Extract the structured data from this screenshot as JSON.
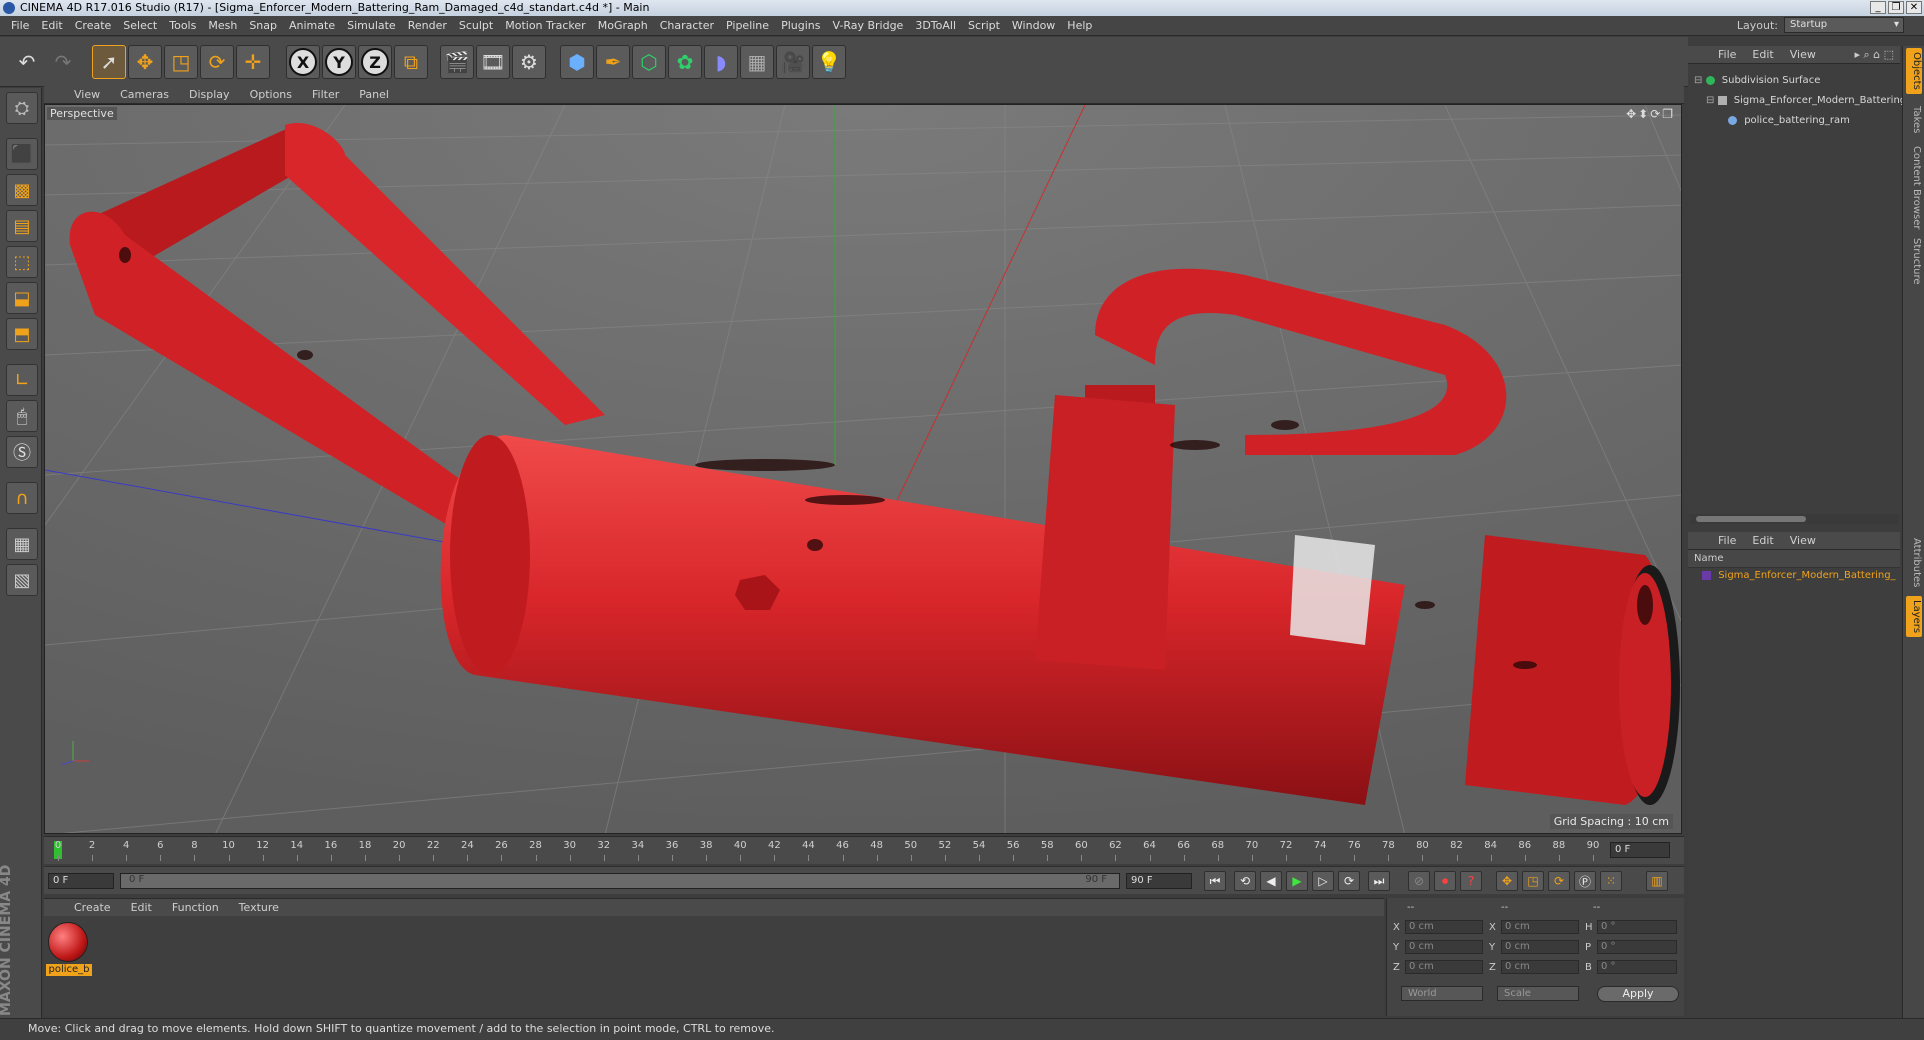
{
  "window": {
    "title": "CINEMA 4D R17.016 Studio (R17) - [Sigma_Enforcer_Modern_Battering_Ram_Damaged_c4d_standart.c4d *] - Main",
    "controls": [
      "_",
      "❐",
      "✕"
    ]
  },
  "menubar": {
    "items": [
      "File",
      "Edit",
      "Create",
      "Select",
      "Tools",
      "Mesh",
      "Snap",
      "Animate",
      "Simulate",
      "Render",
      "Sculpt",
      "Motion Tracker",
      "MoGraph",
      "Character",
      "Pipeline",
      "Plugins",
      "V-Ray Bridge",
      "3DToAll",
      "Script",
      "Window",
      "Help"
    ],
    "layout_label": "Layout:",
    "layout_value": "Startup"
  },
  "toolbar": {
    "axis_x": "X",
    "axis_y": "Y",
    "axis_z": "Z"
  },
  "viewport": {
    "menu": [
      "View",
      "Cameras",
      "Display",
      "Options",
      "Filter",
      "Panel"
    ],
    "label": "Perspective",
    "grid_spacing": "Grid Spacing : 10 cm",
    "icons": "✥⬍⟳❐"
  },
  "timeline": {
    "ticks": [
      "0",
      "2",
      "4",
      "6",
      "8",
      "10",
      "12",
      "14",
      "16",
      "18",
      "20",
      "22",
      "24",
      "26",
      "28",
      "30",
      "32",
      "34",
      "36",
      "38",
      "40",
      "42",
      "44",
      "46",
      "48",
      "50",
      "52",
      "54",
      "56",
      "58",
      "60",
      "62",
      "64",
      "66",
      "68",
      "70",
      "72",
      "74",
      "76",
      "78",
      "80",
      "82",
      "84",
      "86",
      "88",
      "90"
    ],
    "current_frame": "0 F",
    "start_field": "0 F",
    "range_start": "0 F",
    "range_end": "90 F",
    "end_field": "90 F"
  },
  "material": {
    "menu": [
      "Create",
      "Edit",
      "Function",
      "Texture"
    ],
    "name": "police_b"
  },
  "coords": {
    "headers": [
      "--",
      "--",
      "--"
    ],
    "rows": [
      {
        "l1": "X",
        "v1": "0 cm",
        "l2": "X",
        "v2": "0 cm",
        "l3": "H",
        "v3": "0 °"
      },
      {
        "l1": "Y",
        "v1": "0 cm",
        "l2": "Y",
        "v2": "0 cm",
        "l3": "P",
        "v3": "0 °"
      },
      {
        "l1": "Z",
        "v1": "0 cm",
        "l2": "Z",
        "v2": "0 cm",
        "l3": "B",
        "v3": "0 °"
      }
    ],
    "mode1": "World",
    "mode2": "Scale",
    "apply": "Apply"
  },
  "objects": {
    "menu": [
      "File",
      "Edit",
      "View"
    ],
    "items": [
      {
        "name": "Subdivision Surface",
        "color": "#2fb55a"
      },
      {
        "name": "Sigma_Enforcer_Modern_Battering",
        "color": "#b0b0b0"
      },
      {
        "name": "police_battering_ram",
        "color": "#7aa8e0"
      }
    ]
  },
  "layers": {
    "menu": [
      "File",
      "Edit",
      "View"
    ],
    "header": "Name",
    "item": "Sigma_Enforcer_Modern_Battering_"
  },
  "sidetabs": [
    "Objects",
    "Takes",
    "Content Browser",
    "Structure",
    "Attributes",
    "Layers"
  ],
  "status": "Move: Click and drag to move elements. Hold down SHIFT to quantize movement / add to the selection in point mode, CTRL to remove.",
  "branding": "MAXON CINEMA 4D",
  "colors": {
    "accent": "#f0a21b",
    "ram_red": "#d8262a",
    "viewport_bg": "#6e6e6e"
  }
}
